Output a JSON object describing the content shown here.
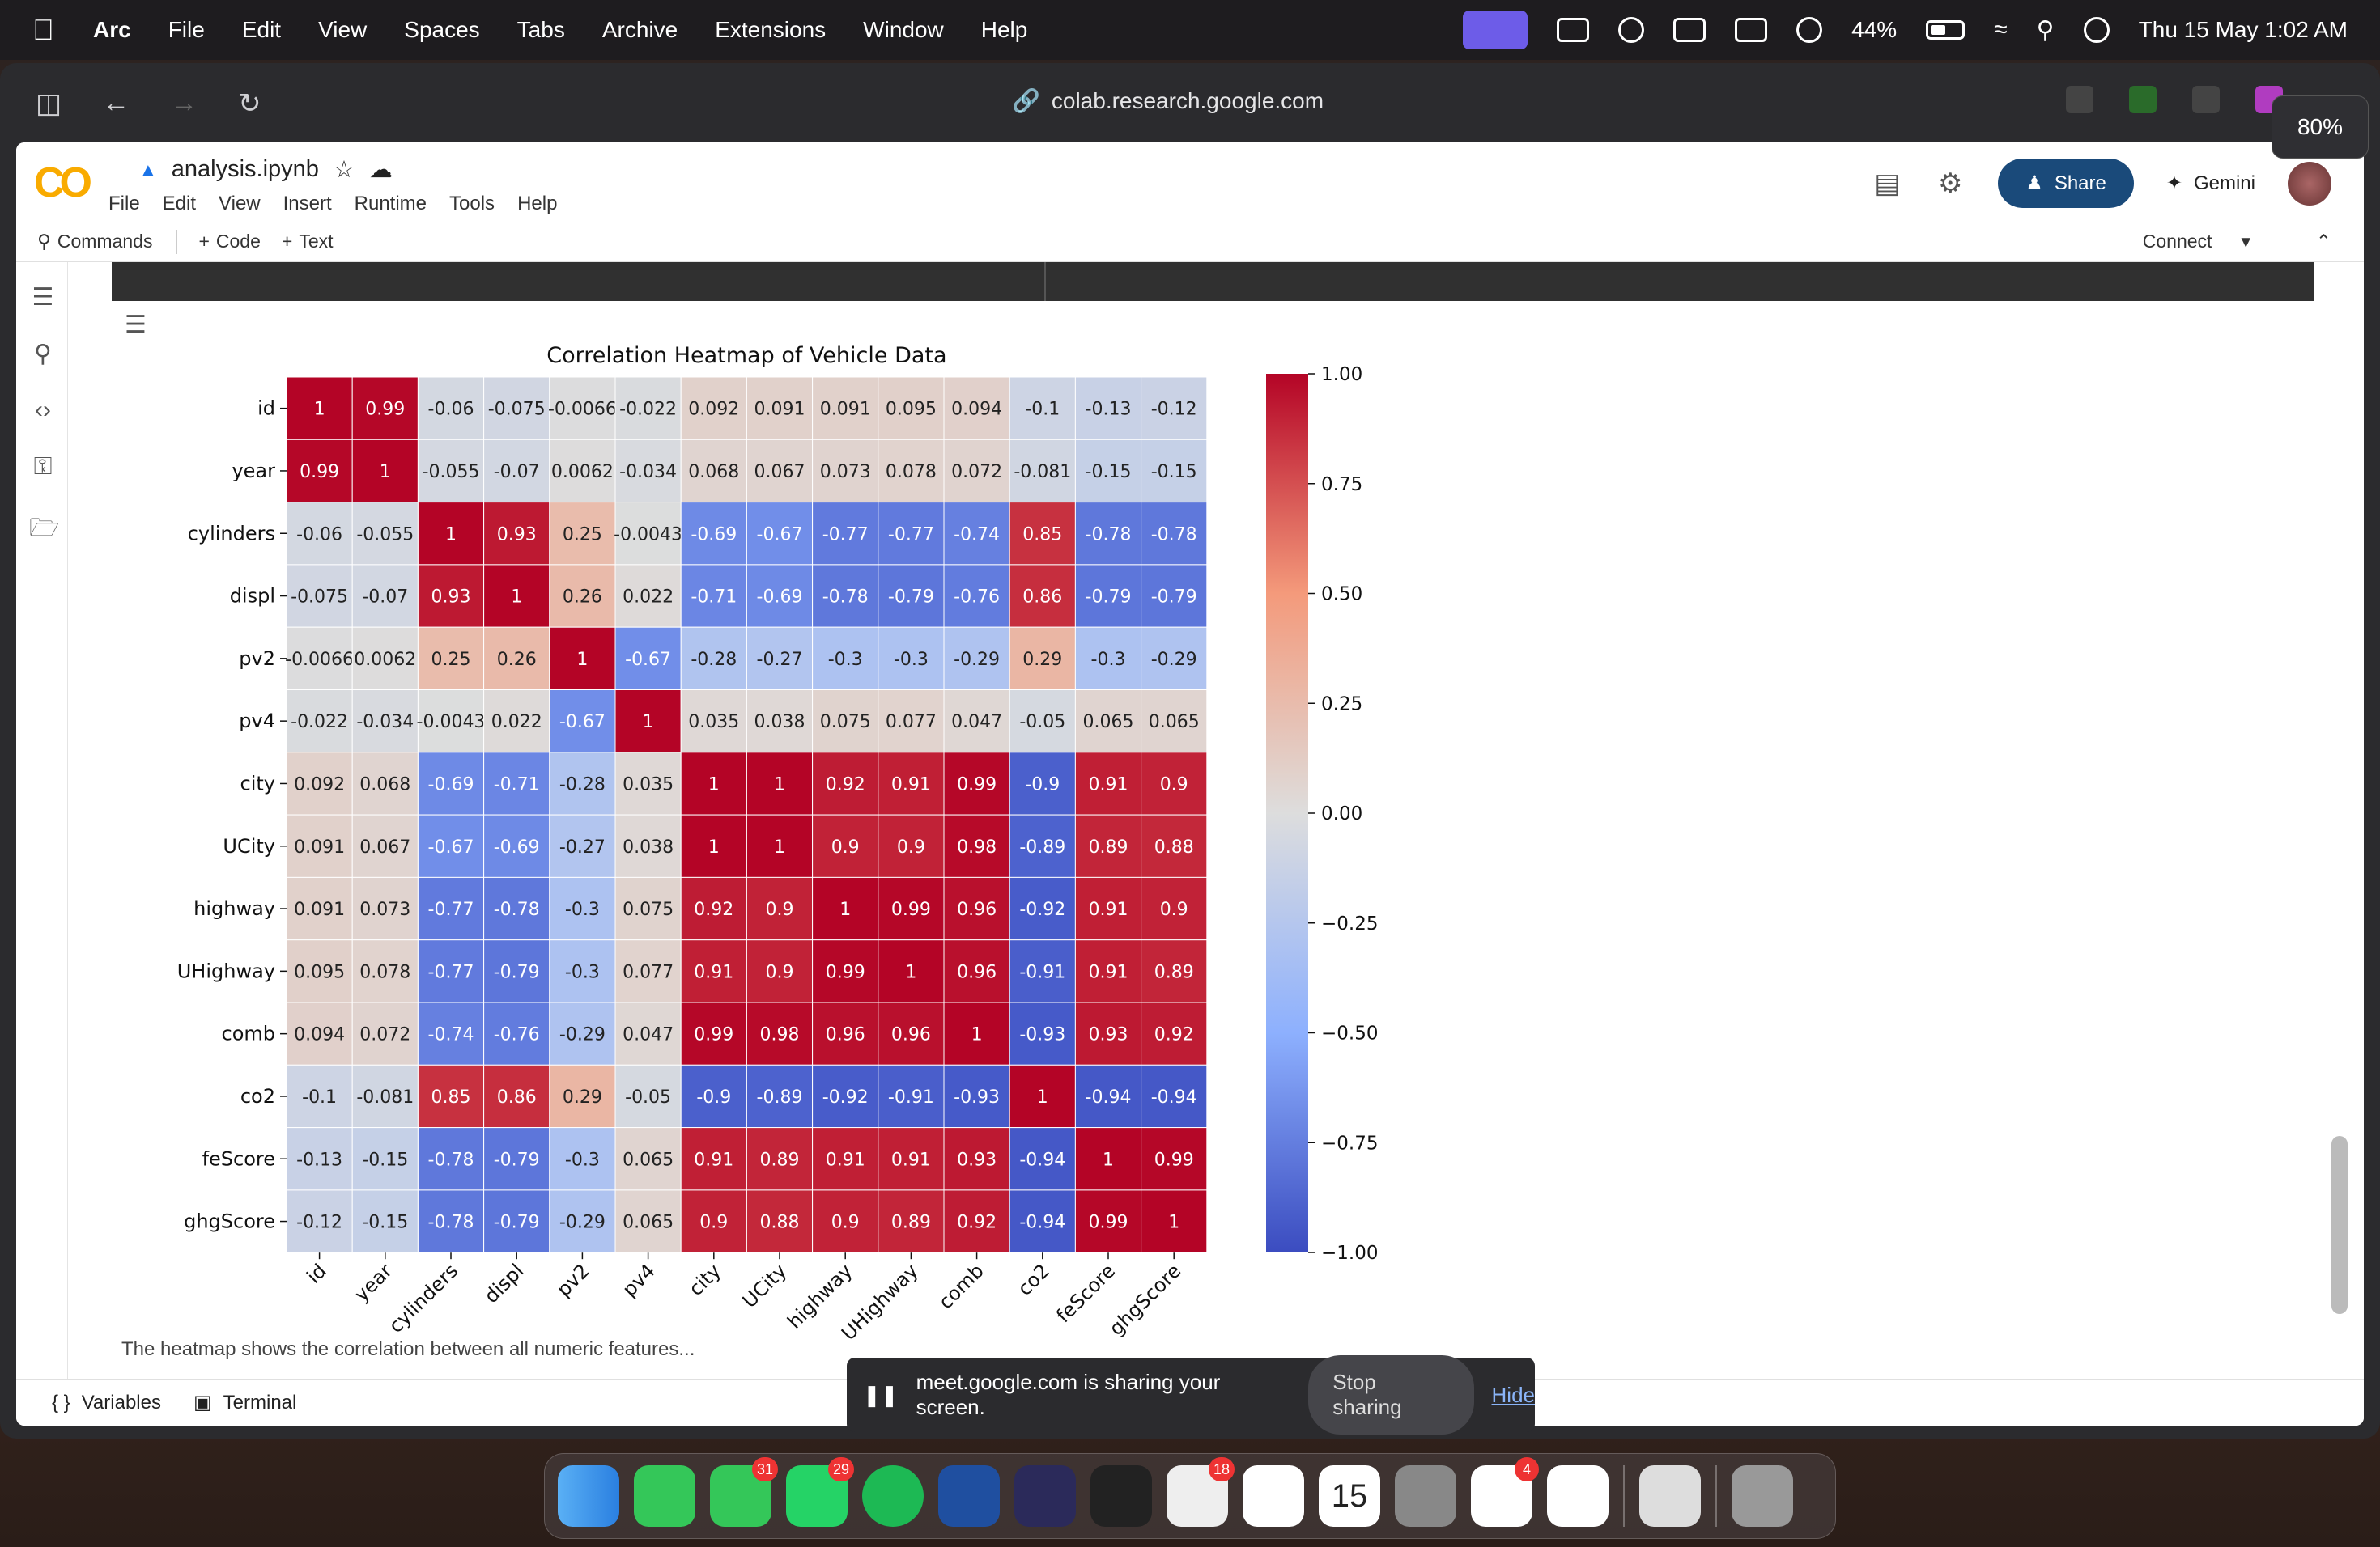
{
  "menubar": {
    "app_name": "Arc",
    "items": [
      "File",
      "Edit",
      "View",
      "Spaces",
      "Tabs",
      "Archive",
      "Extensions",
      "Window",
      "Help"
    ],
    "battery": "44%",
    "datetime": "Thu 15 May  1:02 AM"
  },
  "browser": {
    "url": "colab.research.google.com",
    "zoom": "80%"
  },
  "colab": {
    "notebook_title": "analysis.ipynb",
    "menu": [
      "File",
      "Edit",
      "View",
      "Insert",
      "Runtime",
      "Tools",
      "Help"
    ],
    "share_label": "Share",
    "gemini_label": "Gemini",
    "toolbar": {
      "commands": "Commands",
      "code": "Code",
      "text": "Text",
      "connect": "Connect"
    },
    "bottom": {
      "variables": "Variables",
      "terminal": "Terminal"
    },
    "next_cell_text": "The heatmap shows the correlation between all numeric features..."
  },
  "share_banner": {
    "message": "meet.google.com is sharing your screen.",
    "stop_label": "Stop sharing",
    "hide_label": "Hide"
  },
  "dock_badges": {
    "messages": "31",
    "whatsapp": "29",
    "spark": "18",
    "calendar_day": "15",
    "slack": "4"
  },
  "colors": {
    "accent_blue": "#1a4a7a",
    "heat_low": "#3b4cc0",
    "heat_mid": "#dddddd",
    "heat_high": "#b40426"
  },
  "chart_data": {
    "type": "heatmap",
    "title": "Correlation Heatmap of Vehicle Data",
    "labels": [
      "id",
      "year",
      "cylinders",
      "displ",
      "pv2",
      "pv4",
      "city",
      "UCity",
      "highway",
      "UHighway",
      "comb",
      "co2",
      "feScore",
      "ghgScore"
    ],
    "matrix": [
      [
        1,
        0.99,
        -0.06,
        -0.075,
        -0.0066,
        -0.022,
        0.092,
        0.091,
        0.091,
        0.095,
        0.094,
        -0.1,
        -0.13,
        -0.12
      ],
      [
        0.99,
        1,
        -0.055,
        -0.07,
        0.0062,
        -0.034,
        0.068,
        0.067,
        0.073,
        0.078,
        0.072,
        -0.081,
        -0.15,
        -0.15
      ],
      [
        -0.06,
        -0.055,
        1,
        0.93,
        0.25,
        -0.0043,
        -0.69,
        -0.67,
        -0.77,
        -0.77,
        -0.74,
        0.85,
        -0.78,
        -0.78
      ],
      [
        -0.075,
        -0.07,
        0.93,
        1,
        0.26,
        0.022,
        -0.71,
        -0.69,
        -0.78,
        -0.79,
        -0.76,
        0.86,
        -0.79,
        -0.79
      ],
      [
        -0.0066,
        0.0062,
        0.25,
        0.26,
        1,
        -0.67,
        -0.28,
        -0.27,
        -0.3,
        -0.3,
        -0.29,
        0.29,
        -0.3,
        -0.29
      ],
      [
        -0.022,
        -0.034,
        -0.0043,
        0.022,
        -0.67,
        1,
        0.035,
        0.038,
        0.075,
        0.077,
        0.047,
        -0.05,
        0.065,
        0.065
      ],
      [
        0.092,
        0.068,
        -0.69,
        -0.71,
        -0.28,
        0.035,
        1,
        1,
        0.92,
        0.91,
        0.99,
        -0.9,
        0.91,
        0.9
      ],
      [
        0.091,
        0.067,
        -0.67,
        -0.69,
        -0.27,
        0.038,
        1,
        1,
        0.9,
        0.9,
        0.98,
        -0.89,
        0.89,
        0.88
      ],
      [
        0.091,
        0.073,
        -0.77,
        -0.78,
        -0.3,
        0.075,
        0.92,
        0.9,
        1,
        0.99,
        0.96,
        -0.92,
        0.91,
        0.9
      ],
      [
        0.095,
        0.078,
        -0.77,
        -0.79,
        -0.3,
        0.077,
        0.91,
        0.9,
        0.99,
        1,
        0.96,
        -0.91,
        0.91,
        0.89
      ],
      [
        0.094,
        0.072,
        -0.74,
        -0.76,
        -0.29,
        0.047,
        0.99,
        0.98,
        0.96,
        0.96,
        1,
        -0.93,
        0.93,
        0.92
      ],
      [
        -0.1,
        -0.081,
        0.85,
        0.86,
        0.29,
        -0.05,
        -0.9,
        -0.89,
        -0.92,
        -0.91,
        -0.93,
        1,
        -0.94,
        -0.94
      ],
      [
        -0.13,
        -0.15,
        -0.78,
        -0.79,
        -0.3,
        0.065,
        0.91,
        0.89,
        0.91,
        0.91,
        0.93,
        -0.94,
        1,
        0.99
      ],
      [
        -0.12,
        -0.15,
        -0.78,
        -0.79,
        -0.29,
        0.065,
        0.9,
        0.88,
        0.9,
        0.89,
        0.92,
        -0.94,
        0.99,
        1
      ]
    ],
    "colorbar": {
      "range": [
        -1,
        1
      ],
      "ticks": [
        "1.00",
        "0.75",
        "0.50",
        "0.25",
        "0.00",
        "−0.25",
        "−0.50",
        "−0.75",
        "−1.00"
      ]
    },
    "colormap": "coolwarm"
  }
}
